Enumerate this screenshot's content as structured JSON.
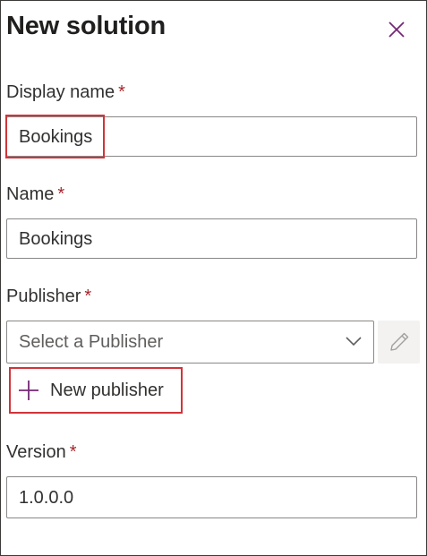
{
  "panel": {
    "title": "New solution",
    "close_icon": "close-icon"
  },
  "required_marker": "*",
  "fields": {
    "display_name": {
      "label": "Display name",
      "value": "Bookings"
    },
    "name": {
      "label": "Name",
      "value": "Bookings"
    },
    "publisher": {
      "label": "Publisher",
      "placeholder": "Select a Publisher",
      "dropdown_icon": "chevron-down-icon",
      "edit_icon": "pencil-icon"
    },
    "version": {
      "label": "Version",
      "value": "1.0.0.0"
    }
  },
  "new_publisher": {
    "label": "New publisher",
    "icon": "plus-icon"
  },
  "colors": {
    "accent": "#742774",
    "required": "#a4262c",
    "highlight": "#d13438"
  }
}
